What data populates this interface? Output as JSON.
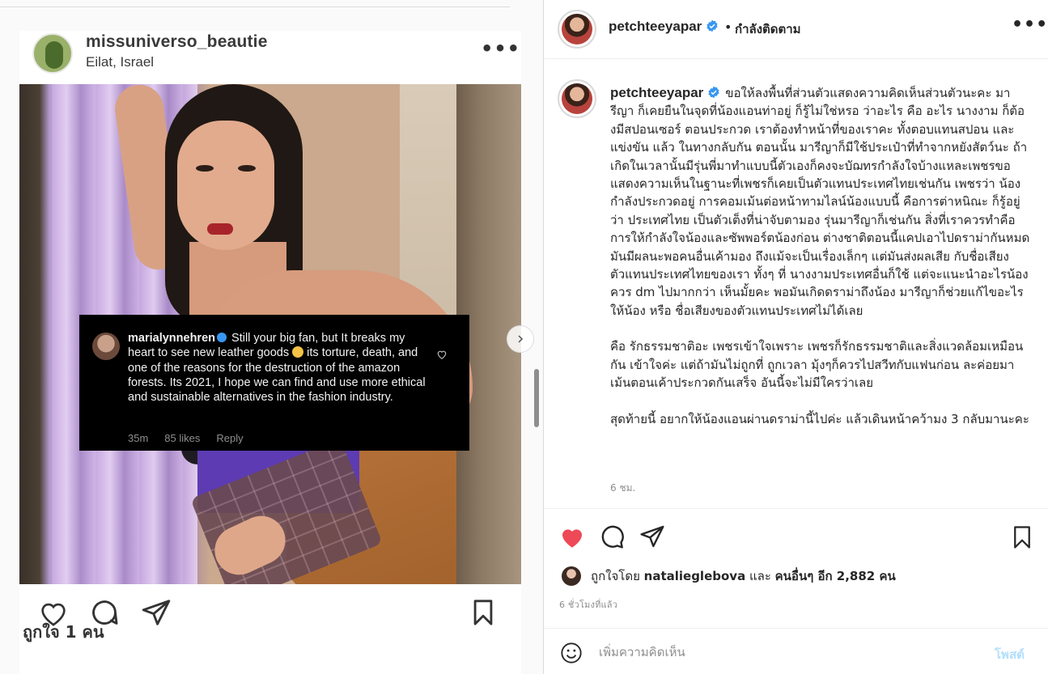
{
  "media": {
    "inner_post": {
      "username": "missuniverso_beautie",
      "location": "Eilat, Israel",
      "more_label": "•••",
      "likes_text": "ถูกใจ 1 คน",
      "overlay_comment": {
        "username": "marialynnehren",
        "text_before_emoji": " Still your big fan, but It breaks my heart to see new leather goods ",
        "text_after_emoji": " its torture, death, and one of the reasons for the destruction of the amazon forests. Its 2021, I hope we can find and use more ethical and sustainable alternatives in the fashion industry.",
        "time": "35m",
        "likes": "85 likes",
        "reply": "Reply"
      }
    }
  },
  "post": {
    "username": "petchteeyapar",
    "separator": "•",
    "follow_status": "กำลังติดตาม",
    "more_label": "•••",
    "caption_paragraphs": [
      "ขอให้ลงพื้นที่ส่วนตัวแสดงความคิดเห็นส่วนตัวนะคะ มารีญา ก็เคยยืนในจุดที่น้องแอนท่าอยู่ ก็รู้ไม่ใช่หรอ ว่าอะไร คือ อะไร นางงาม ก็ต้องมีสปอนเซอร์ ตอนประกวด เราต้องทำหน้าที่ของเราคะ ทั้งตอบแทนสปอน และแข่งขัน แล้ว ในทางกลับกัน ตอนนั้น มารีญาก็มีใช้ประเป๋าที่ทำจากหยังสัตว์นะ ถ้าเกิดในเวลานั้นมีรุ่นพี่มาทำแบบนี้ตัวเองก็คงจะบัฌทรกำลังใจบ้างแหละเพชรขอแสดงความเห็นในฐานะที่เพชรก็เคยเป็นตัวแทนประเทศไทยเช่นกัน เพชรว่า น้องกำลังประกวดอยู่ การคอมเม้นต่อหน้าทามไลน์น้องแบบนี้ คือการต่าหนิณะ ก็รู้อยู่ว่า ประเทศไทย เป็นตัวเต็งที่น่าจับตามอง รุ่นมารีญาก็เช่นกัน สิ่งที่เราควรทำคือการให้กำลังใจน้องและซัพพอร์ตน้องก่อน ต่างชาติตอนนี้แคปเอาไปดราม่ากันหมด มันมีผลนะพอคนอื่นเค้ามอง ถึงแม้จะเป็นเรื่องเล็กๆ แต่มันส่งผลเสีย กับชื่อเสียงตัวแทนประเทศไทยของเรา ทั้งๆ ที่ นางงามประเทศอื่นก็ใช้ แต่จะแนะนำอะไรน้องควร dm ไปมากกว่า เห็นมั้ยคะ พอมันเกิดดราม่าถึงน้อง มารีญาก็ช่วยแก้ไขอะไรให้น้อง หรือ ชื่อเสียงของตัวแทนประเทศไม่ได้เลย",
      "คือ รักธรรมชาติอะ เพชรเข้าใจเพราะ เพชรก็รักธรรมชาติและสิ่งแวดล้อมเหมือนกัน เข้าใจค่ะ แต่ถ้ามันไม่ถูกที่ ถูกเวลา มุ้งๆก็ควรไปสวีทกับแฟนก่อน ละค่อยมาเม้นตอนเค้าประกวดกันเสร็จ อันนี้จะไม่มีใครว่าเลย",
      "สุดท้ายนี้ อยากให้น้องแอนผ่านดราม่านี้ไปค่ะ แล้วเดินหน้าคว้ามง 3 กลับมานะคะ"
    ],
    "caption_time": "6 ชม.",
    "liked_by_prefix": "ถูกใจโดย ",
    "liked_by_user": "natalieglebova",
    "liked_by_and": " และ ",
    "liked_by_others": "คนอื่นๆ อีก 2,882 คน",
    "time_ago": "6 ชั่วโมงที่แล้ว",
    "comment_placeholder": "เพิ่มความคิดเห็น",
    "post_button": "โพสต์"
  },
  "colors": {
    "verified_blue": "#3897f0",
    "like_red": "#ed4956",
    "post_button_disabled": "#b2dffc",
    "secondary_text": "#8e8e8e"
  }
}
